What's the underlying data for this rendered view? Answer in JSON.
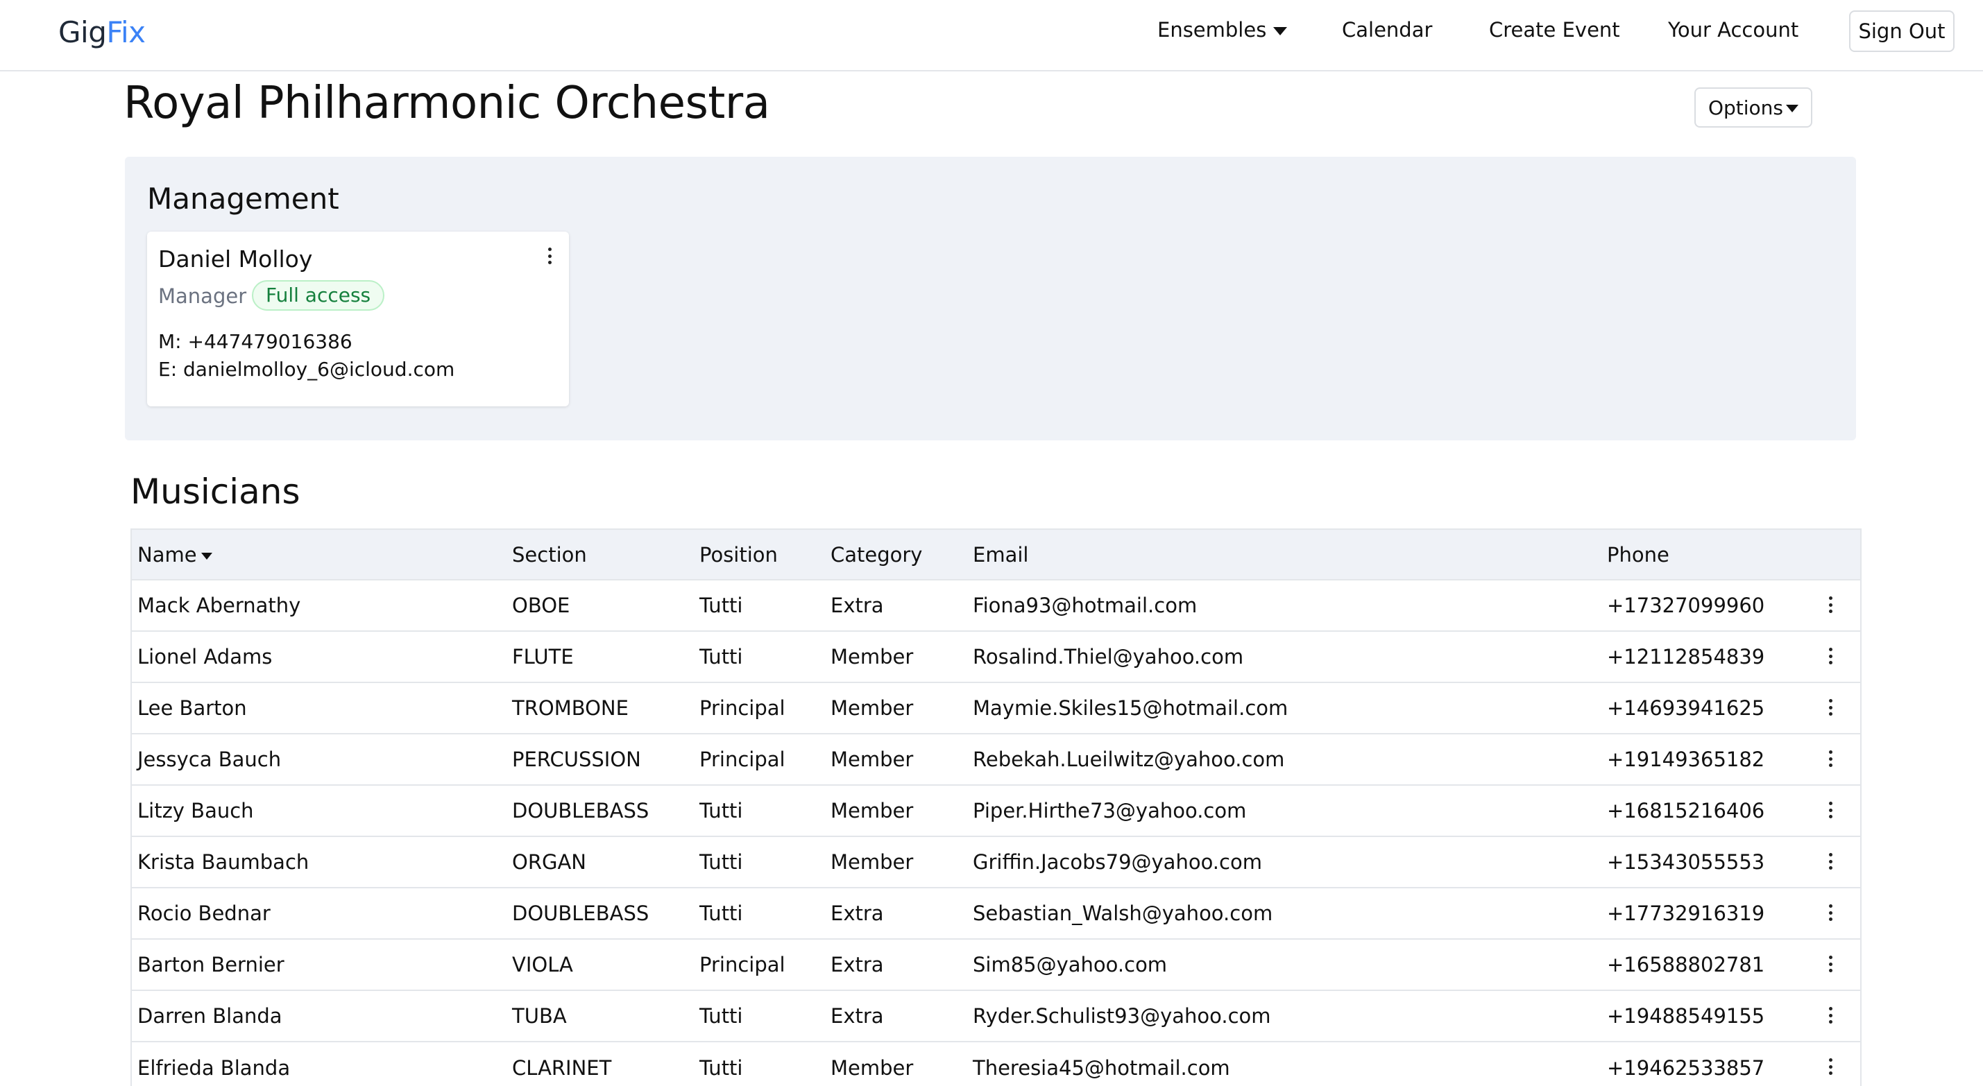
{
  "app": {
    "logo_part1": "Gig",
    "logo_part2": "Fix"
  },
  "nav": {
    "ensembles": "Ensembles",
    "calendar": "Calendar",
    "create_event": "Create Event",
    "your_account": "Your Account",
    "sign_out": "Sign Out"
  },
  "page": {
    "title": "Royal Philharmonic Orchestra",
    "options_label": "Options"
  },
  "management": {
    "heading": "Management",
    "contact": {
      "name": "Daniel Molloy",
      "role": "Manager",
      "badge": "Full access",
      "mobile": "M: +447479016386",
      "email": "E: danielmolloy_6@icloud.com"
    }
  },
  "musicians": {
    "heading": "Musicians",
    "columns": [
      "Name",
      "Section",
      "Position",
      "Category",
      "Email",
      "Phone"
    ],
    "sort_icon": "caret-down-icon",
    "rows": [
      {
        "name": "Mack Abernathy",
        "section": "OBOE",
        "position": "Tutti",
        "category": "Extra",
        "email": "Fiona93@hotmail.com",
        "phone": "+17327099960"
      },
      {
        "name": "Lionel Adams",
        "section": "FLUTE",
        "position": "Tutti",
        "category": "Member",
        "email": "Rosalind.Thiel@yahoo.com",
        "phone": "+12112854839"
      },
      {
        "name": "Lee Barton",
        "section": "TROMBONE",
        "position": "Principal",
        "category": "Member",
        "email": "Maymie.Skiles15@hotmail.com",
        "phone": "+14693941625"
      },
      {
        "name": "Jessyca Bauch",
        "section": "PERCUSSION",
        "position": "Principal",
        "category": "Member",
        "email": "Rebekah.Lueilwitz@yahoo.com",
        "phone": "+19149365182"
      },
      {
        "name": "Litzy Bauch",
        "section": "DOUBLEBASS",
        "position": "Tutti",
        "category": "Member",
        "email": "Piper.Hirthe73@yahoo.com",
        "phone": "+16815216406"
      },
      {
        "name": "Krista Baumbach",
        "section": "ORGAN",
        "position": "Tutti",
        "category": "Member",
        "email": "Griffin.Jacobs79@yahoo.com",
        "phone": "+15343055553"
      },
      {
        "name": "Rocio Bednar",
        "section": "DOUBLEBASS",
        "position": "Tutti",
        "category": "Extra",
        "email": "Sebastian_Walsh@yahoo.com",
        "phone": "+17732916319"
      },
      {
        "name": "Barton Bernier",
        "section": "VIOLA",
        "position": "Principal",
        "category": "Extra",
        "email": "Sim85@yahoo.com",
        "phone": "+16588802781"
      },
      {
        "name": "Darren Blanda",
        "section": "TUBA",
        "position": "Tutti",
        "category": "Extra",
        "email": "Ryder.Schulist93@yahoo.com",
        "phone": "+19488549155"
      },
      {
        "name": "Elfrieda Blanda",
        "section": "CLARINET",
        "position": "Tutti",
        "category": "Member",
        "email": "Theresia45@hotmail.com",
        "phone": "+19462533857"
      }
    ]
  },
  "colors": {
    "accent": "#3b82f6",
    "management_bg": "#eff2f7",
    "badge_green": "#15803d",
    "border": "#e3e6ea"
  }
}
